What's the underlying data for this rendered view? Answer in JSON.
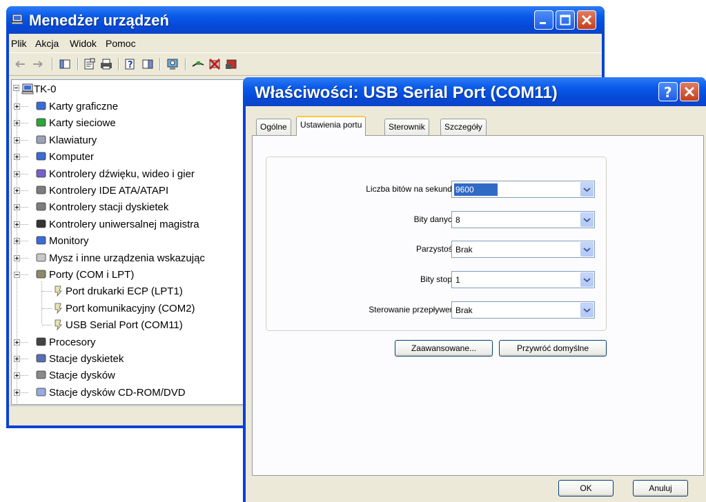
{
  "device_manager": {
    "title": "Menedżer urządzeń",
    "menu": [
      "Plik",
      "Akcja",
      "Widok",
      "Pomoc"
    ],
    "tree": {
      "root": "TK-0",
      "items": [
        {
          "label": "Karty graficzne",
          "icon": "display-adapter-icon"
        },
        {
          "label": "Karty sieciowe",
          "icon": "network-card-icon"
        },
        {
          "label": "Klawiatury",
          "icon": "keyboard-icon"
        },
        {
          "label": "Komputer",
          "icon": "computer-icon"
        },
        {
          "label": "Kontrolery dźwięku, wideo i gier",
          "icon": "sound-icon"
        },
        {
          "label": "Kontrolery IDE ATA/ATAPI",
          "icon": "ide-controller-icon"
        },
        {
          "label": "Kontrolery stacji dyskietek",
          "icon": "floppy-controller-icon"
        },
        {
          "label": "Kontrolery uniwersalnej magistra",
          "icon": "usb-icon"
        },
        {
          "label": "Monitory",
          "icon": "monitor-icon"
        },
        {
          "label": "Mysz i inne urządzenia wskazując",
          "icon": "mouse-icon"
        },
        {
          "label": "Porty (COM i LPT)",
          "icon": "port-icon",
          "expanded": true,
          "children": [
            "Port drukarki ECP (LPT1)",
            "Port komunikacyjny (COM2)",
            "USB Serial Port (COM11)"
          ]
        },
        {
          "label": "Procesory",
          "icon": "processor-icon"
        },
        {
          "label": "Stacje dyskietek",
          "icon": "floppy-drive-icon"
        },
        {
          "label": "Stacje dysków",
          "icon": "disk-drive-icon"
        },
        {
          "label": "Stacje dysków CD-ROM/DVD",
          "icon": "cdrom-icon"
        }
      ]
    }
  },
  "dialog": {
    "title": "Właściwości: USB Serial Port (COM11)",
    "tabs": [
      "Ogólne",
      "Ustawienia portu",
      "Sterownik",
      "Szczegóły"
    ],
    "active_tab": "Ustawienia portu",
    "fields": [
      {
        "label": "Liczba bitów na sekundę:",
        "value": "9600"
      },
      {
        "label": "Bity danych:",
        "value": "8"
      },
      {
        "label": "Parzystość:",
        "value": "Brak"
      },
      {
        "label": "Bity stopu:",
        "value": "1"
      },
      {
        "label": "Sterowanie przepływem:",
        "value": "Brak"
      }
    ],
    "advanced_button": "Zaawansowane...",
    "restore_defaults_button": "Przywróć domyślne",
    "ok_button": "OK",
    "cancel_button": "Anuluj"
  },
  "colors": {
    "titlebar": "#0a5bea",
    "window_face": "#ece9d8",
    "selection": "#316ac5",
    "close_button": "#c4401f"
  }
}
